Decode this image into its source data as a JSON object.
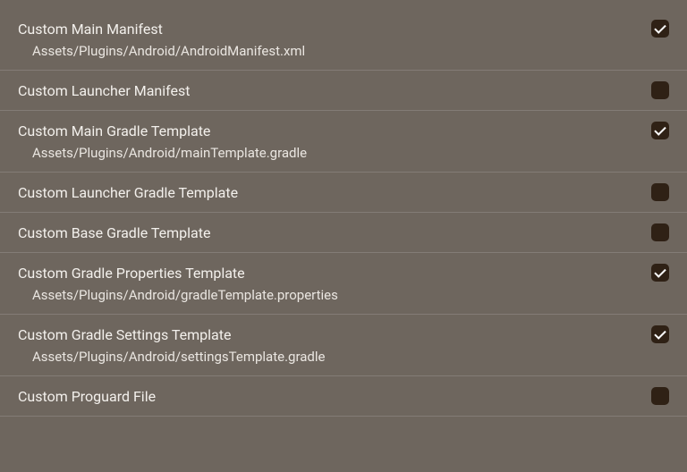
{
  "settings": [
    {
      "label": "Custom Main Manifest",
      "checked": true,
      "path": "Assets/Plugins/Android/AndroidManifest.xml",
      "name": "custom-main-manifest"
    },
    {
      "label": "Custom Launcher Manifest",
      "checked": false,
      "path": null,
      "name": "custom-launcher-manifest"
    },
    {
      "label": "Custom Main Gradle Template",
      "checked": true,
      "path": "Assets/Plugins/Android/mainTemplate.gradle",
      "name": "custom-main-gradle-template"
    },
    {
      "label": "Custom Launcher Gradle Template",
      "checked": false,
      "path": null,
      "name": "custom-launcher-gradle-template"
    },
    {
      "label": "Custom Base Gradle Template",
      "checked": false,
      "path": null,
      "name": "custom-base-gradle-template"
    },
    {
      "label": "Custom Gradle Properties Template",
      "checked": true,
      "path": "Assets/Plugins/Android/gradleTemplate.properties",
      "name": "custom-gradle-properties-template"
    },
    {
      "label": "Custom Gradle Settings Template",
      "checked": true,
      "path": "Assets/Plugins/Android/settingsTemplate.gradle",
      "name": "custom-gradle-settings-template"
    },
    {
      "label": "Custom Proguard File",
      "checked": false,
      "path": null,
      "name": "custom-proguard-file"
    }
  ]
}
